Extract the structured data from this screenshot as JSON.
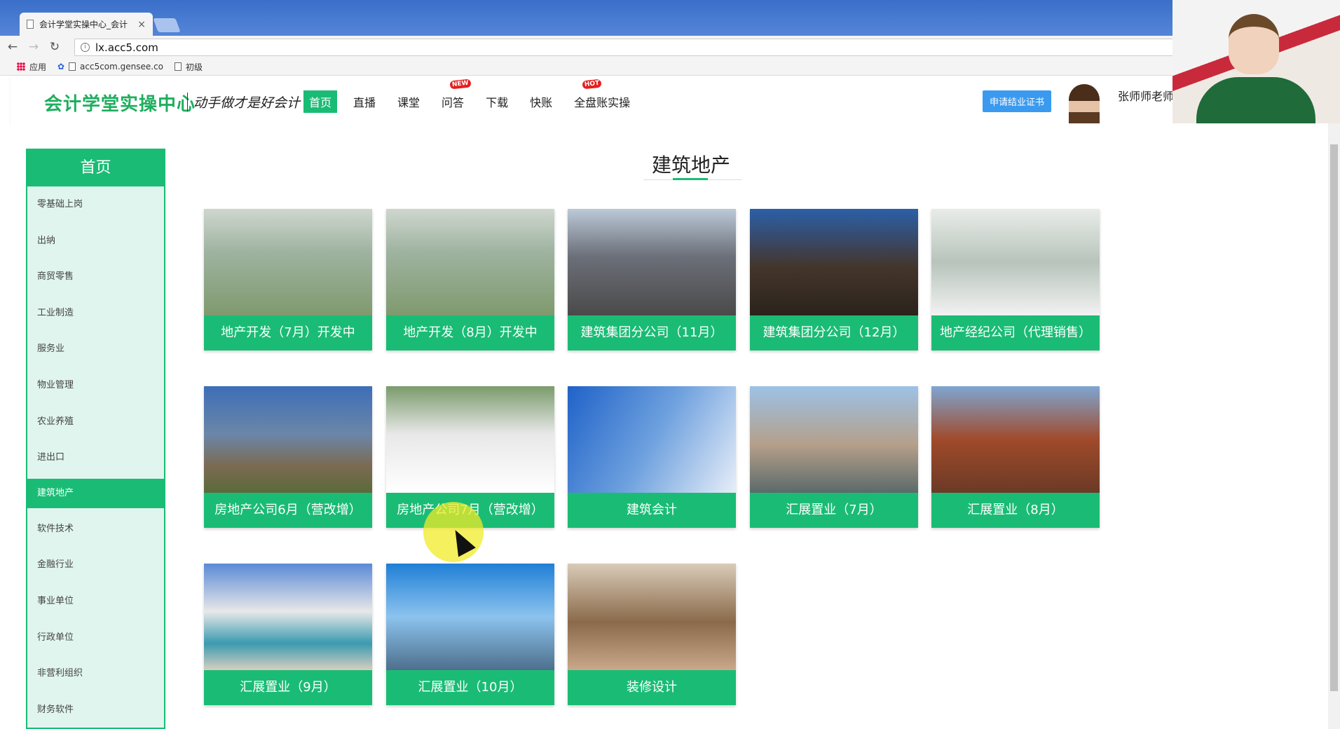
{
  "browser": {
    "tab_title": "会计学堂实操中心_会计",
    "tab_close": "×",
    "url": "lx.acc5.com",
    "bookmarks": [
      "应用",
      "acc5com.gensee.co",
      "初级"
    ]
  },
  "header": {
    "logo": "会计学堂实操中心",
    "slogan": "动手做才是好会计",
    "nav": [
      {
        "label": "首页",
        "active": true
      },
      {
        "label": "直播"
      },
      {
        "label": "课堂"
      },
      {
        "label": "问答",
        "badge": "NEW"
      },
      {
        "label": "下载"
      },
      {
        "label": "快账"
      },
      {
        "label": "全盘账实操",
        "badge": "HOT"
      }
    ],
    "cert_button": "申请结业证书",
    "username": "张师师老师"
  },
  "sidebar": {
    "title": "首页",
    "items": [
      {
        "label": "零基础上岗"
      },
      {
        "label": "出纳"
      },
      {
        "label": "商贸零售"
      },
      {
        "label": "工业制造"
      },
      {
        "label": "服务业"
      },
      {
        "label": "物业管理"
      },
      {
        "label": "农业养殖"
      },
      {
        "label": "进出口"
      },
      {
        "label": "建筑地产",
        "active": true
      },
      {
        "label": "软件技术"
      },
      {
        "label": "金融行业"
      },
      {
        "label": "事业单位"
      },
      {
        "label": "行政单位"
      },
      {
        "label": "非营利组织"
      },
      {
        "label": "财务软件"
      }
    ]
  },
  "main": {
    "title": "建筑地产",
    "cards": [
      {
        "label": "地产开发（7月）开发中",
        "image": "aerial"
      },
      {
        "label": "地产开发（8月）开发中",
        "image": "aerial"
      },
      {
        "label": "建筑集团分公司（11月）",
        "image": "sites"
      },
      {
        "label": "建筑集团分公司（12月）",
        "image": "steel"
      },
      {
        "label": "地产经纪公司（代理销售）",
        "image": "office"
      },
      {
        "label": "房地产公司6月（营改增）",
        "image": "house"
      },
      {
        "label": "房地产公司7月（营改增）",
        "image": "living"
      },
      {
        "label": "建筑会计",
        "image": "tower"
      },
      {
        "label": "汇展置业（7月）",
        "image": "city"
      },
      {
        "label": "汇展置业（8月）",
        "image": "redbld"
      },
      {
        "label": "汇展置业（9月）",
        "image": "beach"
      },
      {
        "label": "汇展置业（10月）",
        "image": "glass"
      },
      {
        "label": "装修设计",
        "image": "interior"
      }
    ]
  },
  "colors": {
    "accent": "#1abc75",
    "sidebar_bg": "#e0f5ee",
    "cert_button": "#3a9af0"
  }
}
